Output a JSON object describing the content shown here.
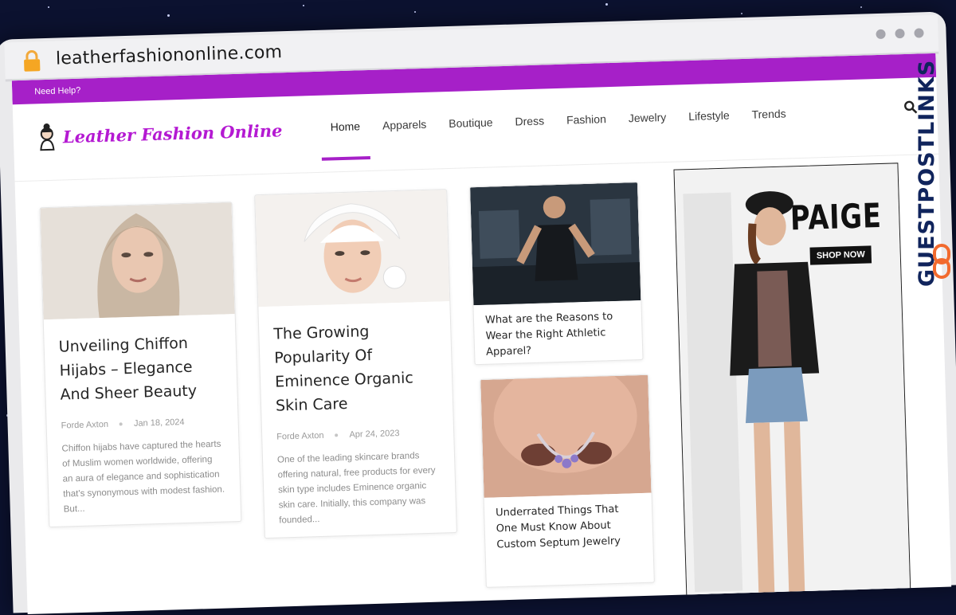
{
  "browser": {
    "url": "leatherfashiononline.com"
  },
  "site": {
    "top_bar_text": "Need Help?",
    "logo_text": "Leather Fashion Online",
    "nav": [
      {
        "label": "Home",
        "active": true
      },
      {
        "label": "Apparels"
      },
      {
        "label": "Boutique"
      },
      {
        "label": "Dress"
      },
      {
        "label": "Fashion"
      },
      {
        "label": "Jewelry"
      },
      {
        "label": "Lifestyle"
      },
      {
        "label": "Trends"
      }
    ],
    "accent_color": "#a620c8"
  },
  "posts": [
    {
      "title": "Unveiling Chiffon Hijabs – Elegance And Sheer Beauty",
      "author": "Forde Axton",
      "date": "Jan 18, 2024",
      "excerpt": "Chiffon hijabs have captured the hearts of Muslim women worldwide, offering an aura of elegance and sophistication that's synonymous with modest fashion. But..."
    },
    {
      "title": "The Growing Popularity Of Eminence Organic Skin Care",
      "author": "Forde Axton",
      "date": "Apr 24, 2023",
      "excerpt": "One of the leading skincare brands offering natural, free products for every skin type includes Eminence organic skin care. Initially, this company was founded..."
    },
    {
      "title": "What are the Reasons to Wear the Right Athletic Apparel?"
    },
    {
      "title": "Underrated Things That One Must Know About Custom Septum Jewelry"
    }
  ],
  "ad": {
    "brand": "PAIGE",
    "cta": "SHOP NOW"
  },
  "watermark": {
    "text": "GUESTPOSTLINKS"
  }
}
